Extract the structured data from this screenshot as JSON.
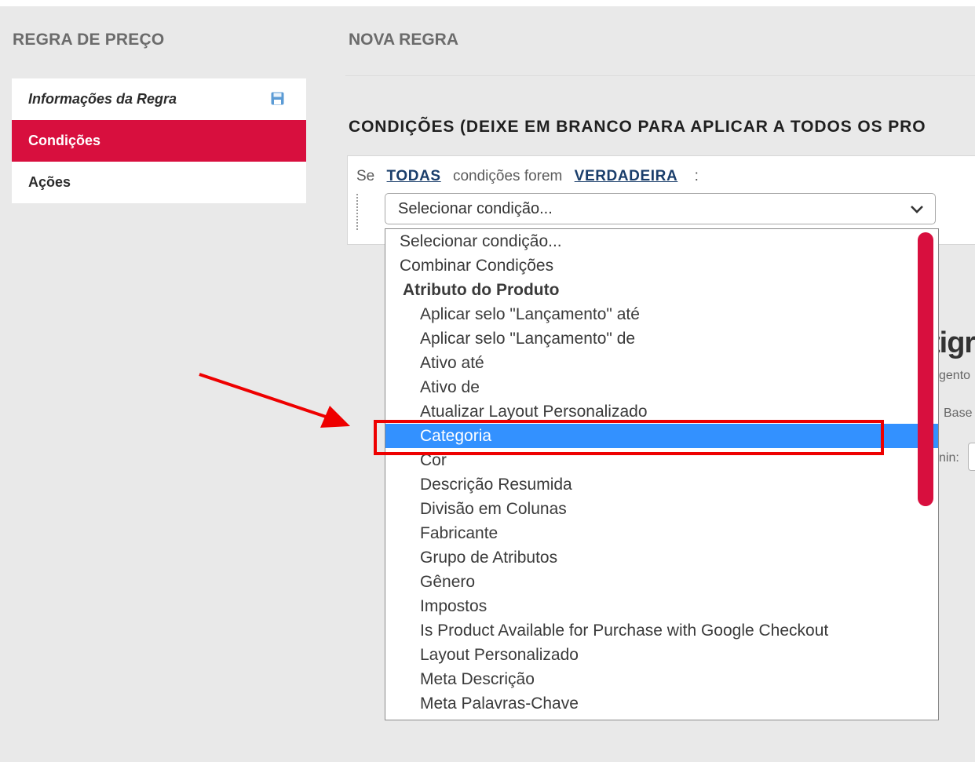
{
  "sidebar": {
    "title": "REGRA DE PREÇO",
    "items": [
      {
        "label": "Informações da Regra"
      },
      {
        "label": "Condições"
      },
      {
        "label": "Ações"
      }
    ]
  },
  "main": {
    "title": "NOVA REGRA",
    "section_title": "CONDIÇÕES (DEIXE EM BRANCO PARA APLICAR A TODOS OS PRO",
    "condition": {
      "prefix": "Se",
      "aggregator": "TODAS",
      "middle": "condições forem",
      "value": "VERDADEIRA",
      "suffix": ":"
    },
    "select": {
      "placeholder": "Selecionar condição...",
      "options": [
        {
          "label": "Selecionar condição..."
        },
        {
          "label": "Combinar Condições"
        },
        {
          "label": "Atributo do Produto"
        },
        {
          "label": "Aplicar selo \"Lançamento\" até"
        },
        {
          "label": "Aplicar selo \"Lançamento\" de"
        },
        {
          "label": "Ativo até"
        },
        {
          "label": "Ativo de"
        },
        {
          "label": "Atualizar Layout Personalizado"
        },
        {
          "label": "Categoria"
        },
        {
          "label": "Cor"
        },
        {
          "label": "Descrição Resumida"
        },
        {
          "label": "Divisão em Colunas"
        },
        {
          "label": "Fabricante"
        },
        {
          "label": "Grupo de Atributos"
        },
        {
          "label": "Gênero"
        },
        {
          "label": "Impostos"
        },
        {
          "label": "Is Product Available for Purchase with Google Checkout"
        },
        {
          "label": "Layout Personalizado"
        },
        {
          "label": "Meta Descrição"
        },
        {
          "label": "Meta Palavras-Chave"
        }
      ],
      "selected": "Categoria"
    },
    "background_fragments": {
      "big": "tigr",
      "line1": "gento",
      "line2": "Base",
      "line3": "nin:"
    }
  },
  "colors": {
    "accent": "#d80f3e",
    "highlight": "#3391ff",
    "link": "#1a3e6b",
    "annotation": "#ee0000"
  },
  "icons": [
    "save-icon",
    "chevron-down-icon"
  ]
}
